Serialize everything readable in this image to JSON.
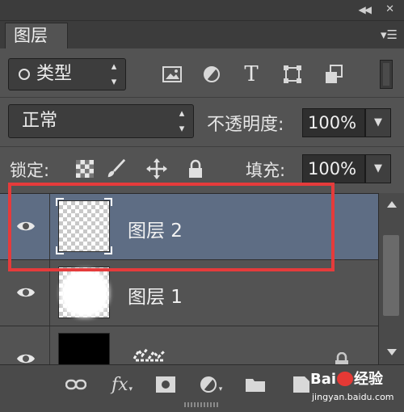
{
  "panel": {
    "tab_label": "图层",
    "filter_kind_label": "类型",
    "blend_mode": "正常",
    "opacity_label": "不透明度:",
    "opacity_value": "100%",
    "lock_label": "锁定:",
    "fill_label": "填充:",
    "fill_value": "100%"
  },
  "layers": [
    {
      "name": "图层 2",
      "selected": true,
      "thumbnail": "transparent-checkerboard"
    },
    {
      "name": "图层 1",
      "selected": false,
      "thumbnail": "white-blob-on-checkerboard"
    },
    {
      "name": "",
      "selected": false,
      "thumbnail": "black-fill",
      "locked": true
    }
  ],
  "bottom_icons": [
    "link-icon",
    "fx-icon",
    "mask-icon",
    "adjustment-icon",
    "group-folder-icon",
    "new-layer-icon"
  ],
  "bottom_fx_label": "fx",
  "watermark": {
    "line1_a": "Bai",
    "line1_b": "经验",
    "line2": "jingyan.baidu.com"
  },
  "colors": {
    "panel_bg": "#535353",
    "selected_layer": "#5e6d84",
    "highlight_box": "#e53b3b"
  }
}
